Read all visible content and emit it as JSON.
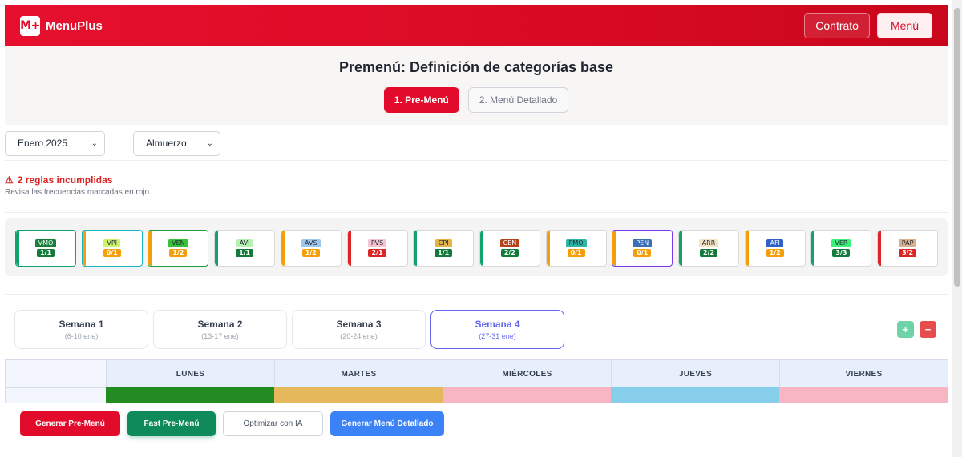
{
  "header": {
    "logo": "M+",
    "brand": "MenuPlus",
    "contrato_label": "Contrato",
    "menu_label": "Menú"
  },
  "title": "Premenú: Definición de categorías base",
  "steps": [
    {
      "label": "1. Pre-Menú",
      "active": true
    },
    {
      "label": "2. Menú Detallado",
      "active": false
    }
  ],
  "filters": {
    "month": "Enero 2025",
    "meal": "Almuerzo"
  },
  "alert": {
    "icon": "warning-icon",
    "title": "2 reglas incumplidas",
    "subtitle": "Revisa las frecuencias marcadas en rojo"
  },
  "categories": [
    {
      "code": "VMO",
      "ratio": "1/1",
      "code_bg": "#1a7f3a",
      "code_fg": "#ffffff",
      "ratio_bg": "#137a3a",
      "edge": "#10a36b",
      "selected": true,
      "border": "#10a36b"
    },
    {
      "code": "VPI",
      "ratio": "0/1",
      "code_bg": "#c8f56a",
      "code_fg": "#1f2937",
      "ratio_bg": "#f59e0b",
      "edge": "#f59e0b",
      "selected": true,
      "border": "#14b8c4"
    },
    {
      "code": "VEN",
      "ratio": "1/2",
      "code_bg": "#37c23a",
      "code_fg": "#1f2937",
      "ratio_bg": "#f59e0b",
      "edge": "#f59e0b",
      "selected": true,
      "border": "#1f9d3a"
    },
    {
      "code": "AVI",
      "ratio": "1/1",
      "code_bg": "#b6f2b0",
      "code_fg": "#1f2937",
      "ratio_bg": "#137a3a",
      "edge": "#10a36b",
      "selected": false,
      "border": "#d9d9d9"
    },
    {
      "code": "AVS",
      "ratio": "1/2",
      "code_bg": "#9cc8ee",
      "code_fg": "#1f2937",
      "ratio_bg": "#f59e0b",
      "edge": "#f59e0b",
      "selected": false,
      "border": "#d9d9d9"
    },
    {
      "code": "PVS",
      "ratio": "2/1",
      "code_bg": "#f7c3d3",
      "code_fg": "#1f2937",
      "ratio_bg": "#dc2626",
      "edge": "#dc2626",
      "selected": false,
      "border": "#d9d9d9"
    },
    {
      "code": "CPI",
      "ratio": "1/1",
      "code_bg": "#e3b347",
      "code_fg": "#1f2937",
      "ratio_bg": "#137a3a",
      "edge": "#10a36b",
      "selected": false,
      "border": "#d9d9d9"
    },
    {
      "code": "CEN",
      "ratio": "2/2",
      "code_bg": "#b5421f",
      "code_fg": "#ffffff",
      "ratio_bg": "#137a3a",
      "edge": "#10a36b",
      "selected": false,
      "border": "#d9d9d9"
    },
    {
      "code": "PMO",
      "ratio": "0/1",
      "code_bg": "#2fb5a6",
      "code_fg": "#1f2937",
      "ratio_bg": "#f59e0b",
      "edge": "#f59e0b",
      "selected": false,
      "border": "#d9d9d9"
    },
    {
      "code": "PEN",
      "ratio": "0/1",
      "code_bg": "#3b6fb6",
      "code_fg": "#ffffff",
      "ratio_bg": "#f59e0b",
      "edge": "#f59e0b",
      "selected": true,
      "border": "#7c3aed"
    },
    {
      "code": "ARR",
      "ratio": "2/2",
      "code_bg": "#f3e3c3",
      "code_fg": "#1f2937",
      "ratio_bg": "#137a3a",
      "edge": "#10a36b",
      "selected": false,
      "border": "#d9d9d9"
    },
    {
      "code": "AFI",
      "ratio": "1/2",
      "code_bg": "#2f5fc8",
      "code_fg": "#ffffff",
      "ratio_bg": "#f59e0b",
      "edge": "#f59e0b",
      "selected": false,
      "border": "#d9d9d9"
    },
    {
      "code": "VER",
      "ratio": "3/3",
      "code_bg": "#3cf07a",
      "code_fg": "#1f2937",
      "ratio_bg": "#137a3a",
      "edge": "#10a36b",
      "selected": false,
      "border": "#d9d9d9"
    },
    {
      "code": "PAP",
      "ratio": "3/2",
      "code_bg": "#d9b08c",
      "code_fg": "#1f2937",
      "ratio_bg": "#dc2626",
      "edge": "#dc2626",
      "selected": false,
      "border": "#d9d9d9"
    }
  ],
  "weeks": [
    {
      "title": "Semana 1",
      "dates": "(6-10 ene)",
      "active": false
    },
    {
      "title": "Semana 2",
      "dates": "(13-17 ene)",
      "active": false
    },
    {
      "title": "Semana 3",
      "dates": "(20-24 ene)",
      "active": false
    },
    {
      "title": "Semana 4",
      "dates": "(27-31 ene)",
      "active": true
    }
  ],
  "week_controls": {
    "add": "+",
    "remove": "−",
    "add_color": "#6fd3a8",
    "remove_color": "#e74c4c"
  },
  "days": [
    {
      "label": "LUNES",
      "color": "#228b22"
    },
    {
      "label": "MARTES",
      "color": "#e6b85c"
    },
    {
      "label": "MIÉRCOLES",
      "color": "#f8b6c3"
    },
    {
      "label": "JUEVES",
      "color": "#87ceeb"
    },
    {
      "label": "VIERNES",
      "color": "#f8b6c3"
    }
  ],
  "actions": {
    "generate": "Generar Pre-Menú",
    "fast": "Fast Pre-Menú",
    "optimize": "Optimizar con IA",
    "detailed": "Generar Menú Detallado"
  }
}
